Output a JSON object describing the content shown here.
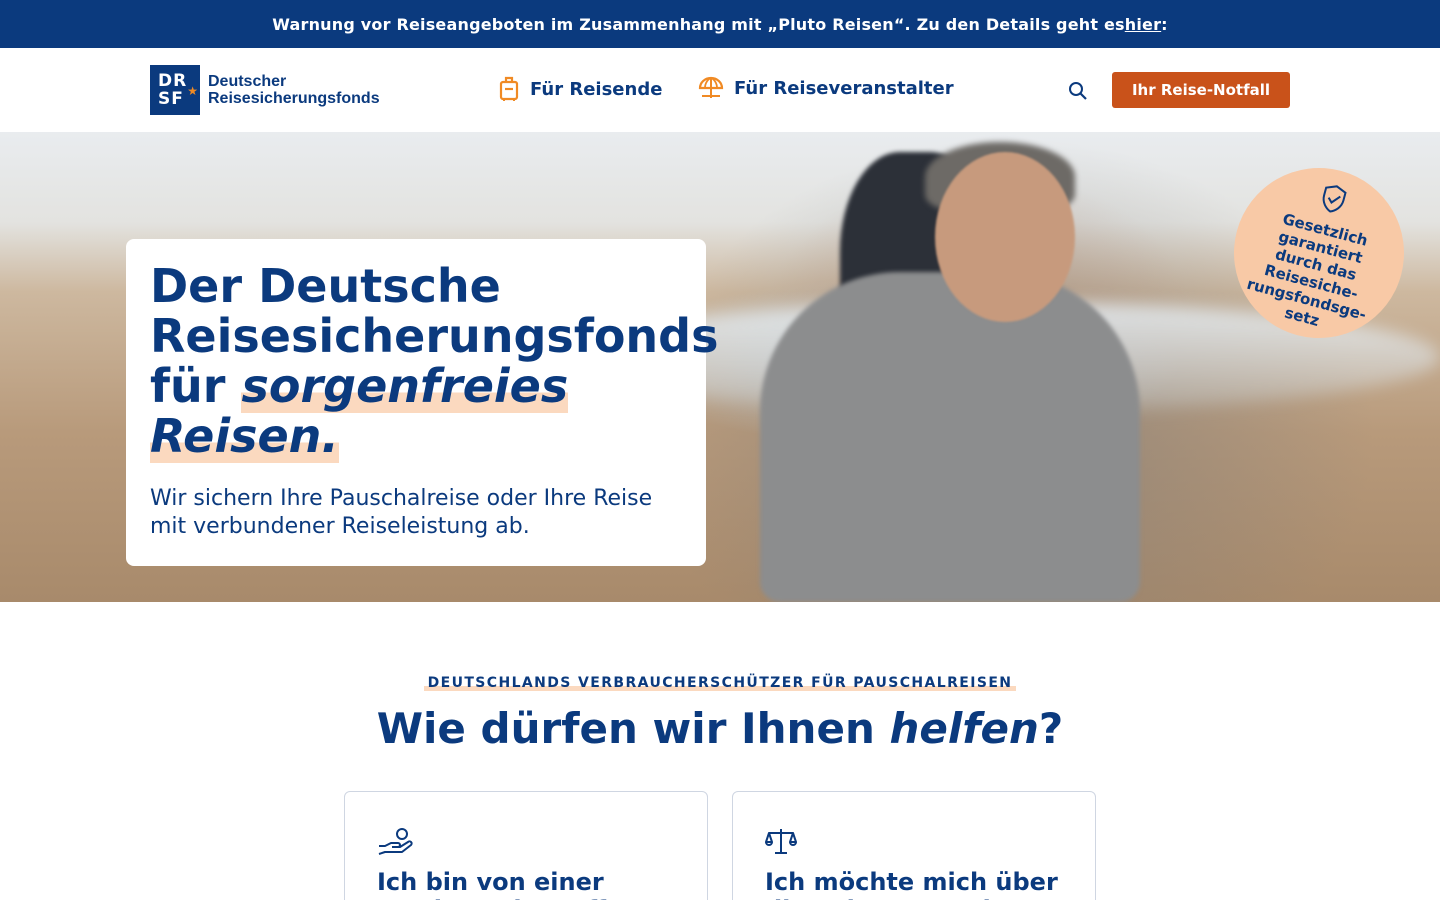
{
  "warning": {
    "text": "Warnung vor Reiseangeboten im Zusammenhang mit „Pluto Reisen“. Zu den Details geht es ",
    "link": "hier",
    "suffix": ":"
  },
  "header": {
    "logo_mark_line1": "DR",
    "logo_mark_line2": "SF",
    "logo_line1": "Deutscher",
    "logo_line2": "Reisesicherungsfonds",
    "nav": [
      {
        "label": "Für Reisende",
        "icon": "suitcase-icon"
      },
      {
        "label": "Für Reiseveranstalter",
        "icon": "umbrella-icon"
      }
    ],
    "search_icon": "search-icon",
    "cta_label": "Ihr Reise-Notfall",
    "accent": "#c9521a",
    "brand": "#0b3a7e"
  },
  "hero": {
    "title_line1": "Der Deutsche",
    "title_line2": "Reisesicherungsfonds",
    "title_line3_prefix": "für ",
    "title_emph1": "sorgenfreies",
    "title_emph2": "Reisen.",
    "subtitle": "Wir sichern Ihre Pauschalreise oder Ihre Reise mit verbundener Reiseleistung ab.",
    "badge_icon": "shield-check-icon",
    "badge_text": "Gesetzlich garantiert durch das Reisesiche-rungsfondsge-setz"
  },
  "help": {
    "eyebrow": "DEUTSCHLANDS VERBRAUCHERSCHÜTZER FÜR PAUSCHALREISEN",
    "title_prefix": "Wie dürfen wir Ihnen ",
    "title_emph": "helfen",
    "title_suffix": "?",
    "cards": [
      {
        "icon": "hand-coin-icon",
        "title": "Ich bin von einer Insolvenz betroffen"
      },
      {
        "icon": "scales-icon",
        "title": "Ich möchte mich über die Leistungen des"
      }
    ]
  }
}
